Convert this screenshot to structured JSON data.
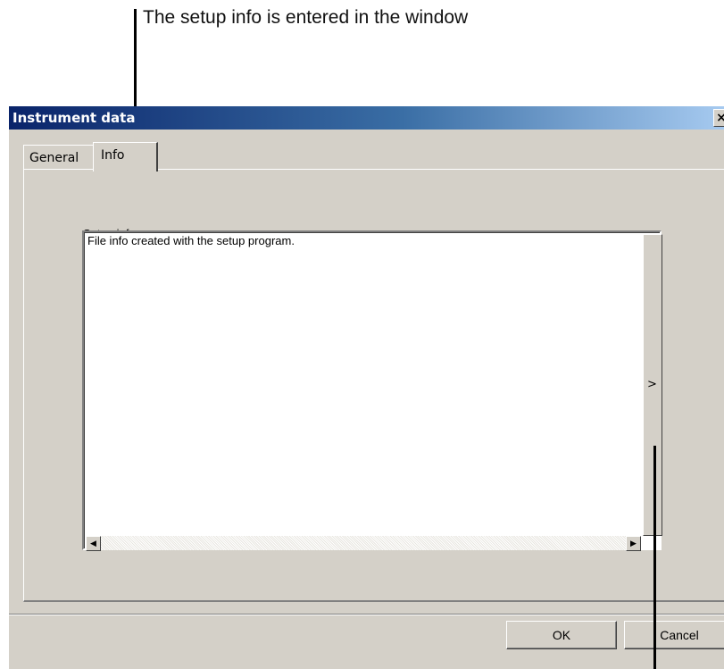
{
  "annotation": {
    "text": "The setup info is entered in the window"
  },
  "dialog": {
    "title": "Instrument data",
    "close_glyph": "×",
    "tabs": [
      {
        "label": "General",
        "active": false
      },
      {
        "label": "Info",
        "active": true
      }
    ],
    "setup_label": "Setup info:",
    "setup_text": "File info created with the setup program.",
    "scroll_left_glyph": "◀",
    "scroll_right_glyph": "▶",
    "vscroll_glyph": ">",
    "ok_label": "OK",
    "cancel_label": "Cancel"
  },
  "colors": {
    "title_gradient_start": "#0a246a",
    "title_gradient_end": "#a6caf0",
    "dialog_face": "#d4d0c8"
  },
  "icons": {
    "close": "close-icon",
    "scroll_left": "scroll-left-icon",
    "scroll_right": "scroll-right-icon"
  }
}
